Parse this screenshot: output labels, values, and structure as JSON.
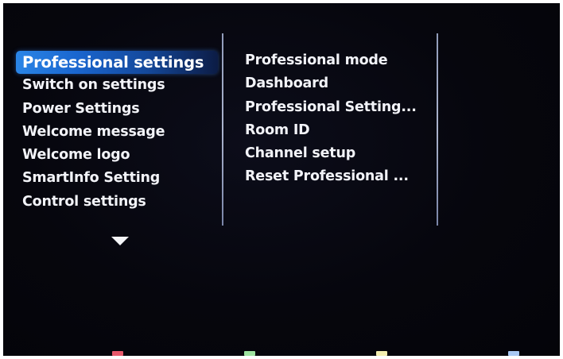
{
  "menu": {
    "items": [
      {
        "label": "Professional settings"
      },
      {
        "label": "Switch on settings"
      },
      {
        "label": "Power Settings"
      },
      {
        "label": "Welcome message"
      },
      {
        "label": "Welcome logo"
      },
      {
        "label": "SmartInfo Setting"
      },
      {
        "label": "Control settings"
      }
    ]
  },
  "submenu": {
    "items": [
      {
        "label": "Professional mode"
      },
      {
        "label": "Dashboard"
      },
      {
        "label": "Professional Setting..."
      },
      {
        "label": "Room ID"
      },
      {
        "label": "Channel setup"
      },
      {
        "label": "Reset Professional ..."
      }
    ]
  },
  "scroll_indicator": {
    "icon": "chevron-down-icon"
  },
  "color_keys": {
    "red": "#e8596b",
    "green": "#9ee3a0",
    "yellow": "#f3eeb0",
    "blue": "#a8c8f4"
  }
}
